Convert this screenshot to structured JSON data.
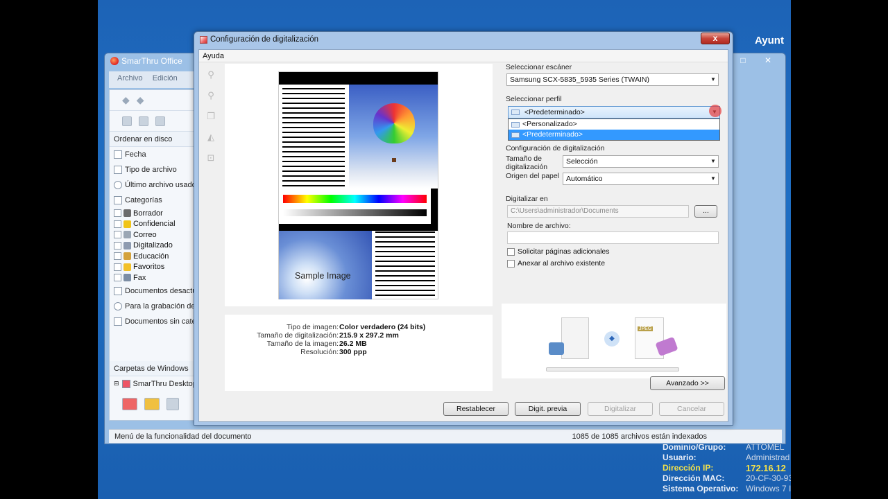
{
  "desktop": {
    "corner_text": "Ayunt",
    "sysinfo": [
      {
        "key": "Dominio/Grupo:",
        "value": "ATTOMEL",
        "yellow": false
      },
      {
        "key": "Usuario:",
        "value": "Administrad",
        "yellow": false
      },
      {
        "key": "Dirección IP:",
        "value": "172.16.12",
        "yellow": true
      },
      {
        "key": "Dirección MAC:",
        "value": "20-CF-30-93",
        "yellow": false
      },
      {
        "key": "Sistema Operativo:",
        "value": "Windows 7 I",
        "yellow": false
      }
    ]
  },
  "smarthru": {
    "title": "SmarThru Office",
    "menu": [
      "Archivo",
      "Edición"
    ],
    "sort_header": "Ordenar en disco",
    "sort_items": [
      "Fecha",
      "Tipo de archivo",
      "Último archivo usado"
    ],
    "categories_header": "Categorías",
    "categories": [
      {
        "label": "Borrador",
        "color": "#6b6b6b"
      },
      {
        "label": "Confidencial",
        "color": "#f0c419"
      },
      {
        "label": "Correo",
        "color": "#9aa6b4"
      },
      {
        "label": "Digitalizado",
        "color": "#8e9bb0"
      },
      {
        "label": "Educación",
        "color": "#d4a23c"
      },
      {
        "label": "Favoritos",
        "color": "#f2c029"
      },
      {
        "label": "Fax",
        "color": "#7d8ea5"
      }
    ],
    "other_items": [
      "Documentos desactua",
      "Para la grabación de",
      "Documentos sin categ"
    ],
    "windows_folders": "Carpetas de Windows",
    "desktop_item": "SmarThru Desktop",
    "status_left": "Menú de la funcionalidad del documento",
    "status_right": "1085 de 1085 archivos están indexados"
  },
  "dialog": {
    "title": "Configuración de digitalización",
    "close_label": "x",
    "menu_help": "Ayuda",
    "sample_text": "Sample Image",
    "image_info": [
      {
        "key": "Tipo de imagen:",
        "value": "Color verdadero (24 bits)"
      },
      {
        "key": "Tamaño de digitalización:",
        "value": "215.9 x 297.2 mm"
      },
      {
        "key": "Tamaño de la imagen:",
        "value": "26.2 MB"
      },
      {
        "key": "Resolución:",
        "value": "300 ppp"
      }
    ],
    "scanner_label": "Seleccionar escáner",
    "scanner_value": "Samsung SCX-5835_5935 Series (TWAIN)",
    "profile_label": "Seleccionar perfil",
    "profile_value": "<Predeterminado>",
    "profile_options": [
      "<Personalizado>",
      "<Predeterminado>"
    ],
    "config_label": "Configuración de digitalización",
    "size_label_1": "Tamaño de",
    "size_label_2": "digitalización",
    "size_value": "Selección",
    "source_label": "Origen del papel",
    "source_value": "Automático",
    "scan_to_label": "Digitalizar en",
    "scan_to_value": "C:\\Users\\administrador\\Documents",
    "browse_label": "...",
    "filename_label": "Nombre de archivo:",
    "filename_value": "",
    "check_more": "Solicitar páginas adicionales",
    "check_append": "Anexar al archivo existente",
    "advanced_button": "Avanzado >>",
    "reset_button": "Restablecer",
    "preview_button": "Digit. previa",
    "scan_button": "Digitalizar",
    "cancel_button": "Cancelar",
    "jpeg_tag": "JPEG"
  }
}
